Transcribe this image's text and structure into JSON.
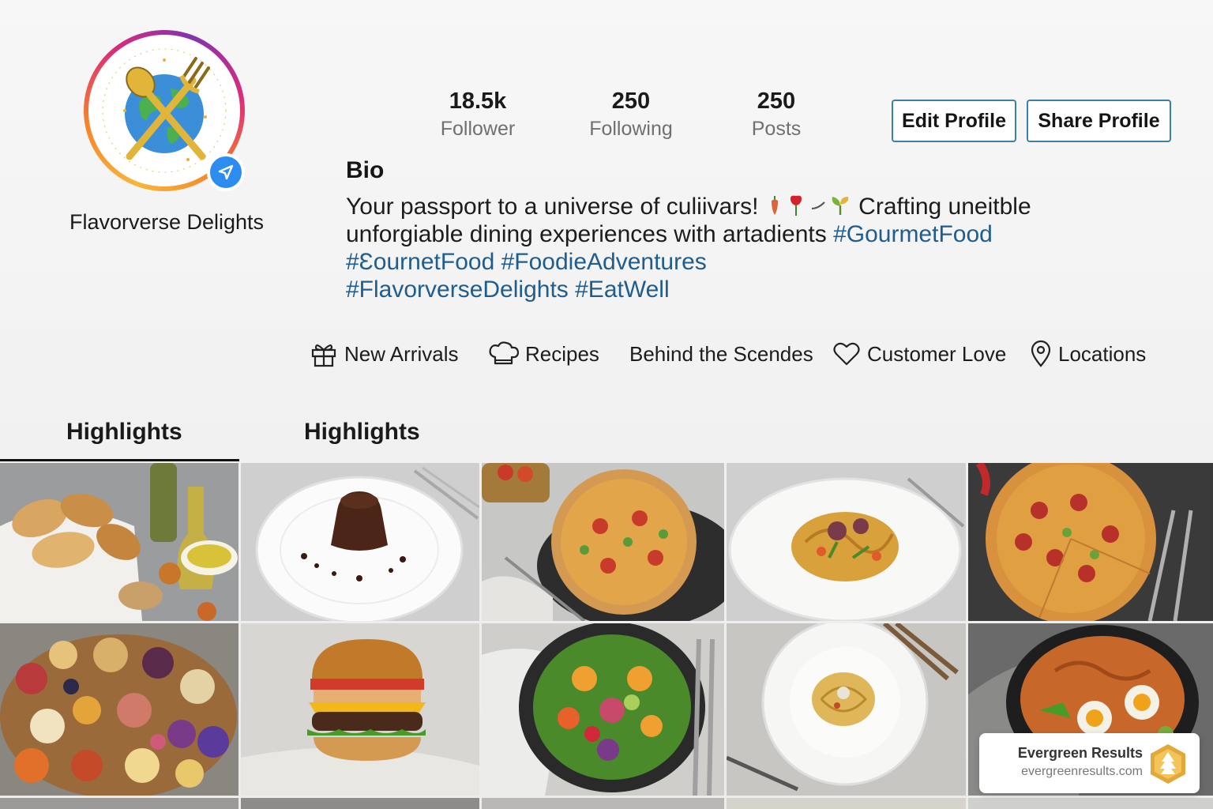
{
  "profile": {
    "username": "Flavorverse Delights",
    "avatar": "globe-fork-spoon-logo",
    "verified_icon": "verified-arrow-badge-icon"
  },
  "stats": {
    "followers": {
      "value": "18.5k",
      "label": "Follower"
    },
    "following": {
      "value": "250",
      "label": "Following"
    },
    "posts": {
      "value": "250",
      "label": "Posts"
    }
  },
  "actions": {
    "edit_label": "Edit Profile",
    "share_label": "Share Profile"
  },
  "bio": {
    "title": "Bio",
    "line1_text": "Your passport to a universe of culiivars! ",
    "line1_emojis": [
      "pepper",
      "rose",
      "twig",
      "sprout"
    ],
    "line1_text2": " Crafting uneitble",
    "line2_text": "unforgiable dining experiences with artadients ",
    "line2_tag": "#GourmetFood",
    "line3_tags": [
      "#ƐournetFood",
      "#FoodieAdventures"
    ],
    "line4_tags": [
      "#FlavorverseDelights",
      "#EatWell"
    ]
  },
  "highlights_nav": [
    {
      "label": "New Arrivals",
      "icon": "gift-icon"
    },
    {
      "label": "Recipes",
      "icon": "chef-hat-icon"
    },
    {
      "label": "Behind the Scendes",
      "icon": ""
    },
    {
      "label": "Customer Love",
      "icon": "heart-icon"
    },
    {
      "label": "Locations",
      "icon": "location-pin-icon"
    }
  ],
  "tabs": [
    {
      "label": "Highlights",
      "active": true
    },
    {
      "label": "Highlights",
      "active": false
    }
  ],
  "posts": [
    {
      "subject": "bread basket with olive oil"
    },
    {
      "subject": "chocolate lava cake"
    },
    {
      "subject": "vegetable pizza"
    },
    {
      "subject": "spaghetti with vegetables"
    },
    {
      "subject": "pepperoni pizza"
    },
    {
      "subject": "charcuterie board"
    },
    {
      "subject": "cheeseburger"
    },
    {
      "subject": "fresh salad bowl"
    },
    {
      "subject": "pasta nest"
    },
    {
      "subject": "ramen bowl with egg"
    }
  ],
  "watermark": {
    "name": "Evergreen Results",
    "url": "evergreenresults.com"
  },
  "colors": {
    "hashtag": "#1f5d8e",
    "button_border": "#3c7fa8",
    "verified": "#2d8cf0"
  }
}
